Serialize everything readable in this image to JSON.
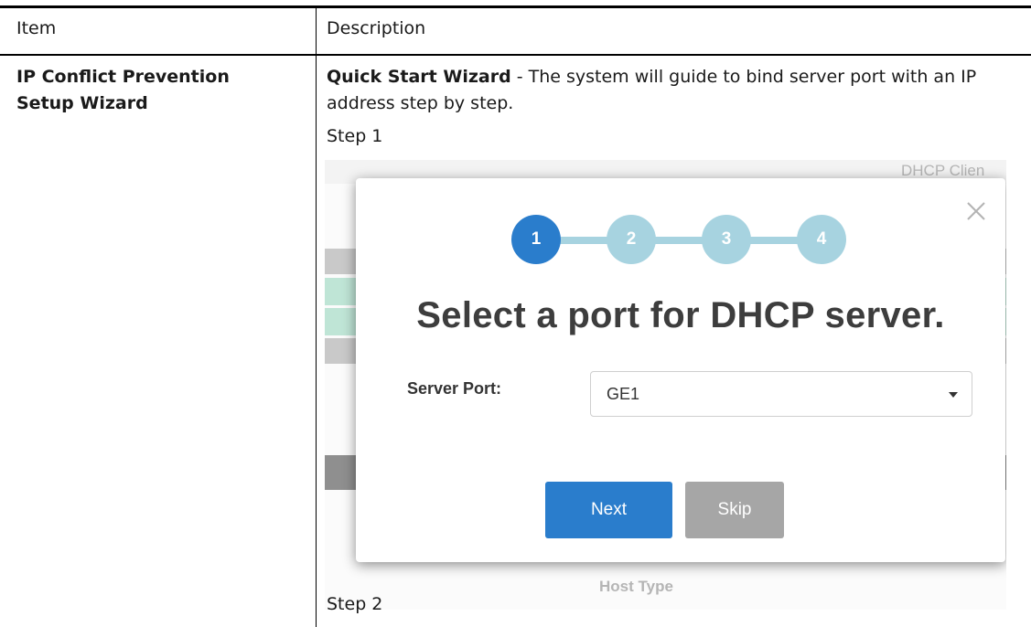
{
  "table": {
    "headers": {
      "item": "Item",
      "description": "Description"
    },
    "row": {
      "item": "IP Conflict Prevention Setup Wizard",
      "description_bold": "Quick Start Wizard",
      "description_rest": " - The system will guide to bind server port with an IP address step by step.",
      "step1_label": "Step 1",
      "step2_label": "Step 2"
    }
  },
  "wizard": {
    "steps": [
      "1",
      "2",
      "3",
      "4"
    ],
    "active_step": 1,
    "title": "Select a port for DHCP server.",
    "server_port_label": "Server Port:",
    "server_port_value": "GE1",
    "next_label": "Next",
    "skip_label": "Skip"
  },
  "background_fragments": {
    "host_type": "Host Type",
    "dhcp_client": "DHCP Clien"
  },
  "colors": {
    "active_step": "#2a7dcc",
    "inactive_step": "#a7d3e0",
    "next_button": "#2a7dcc",
    "skip_button": "#a6a6a6"
  }
}
